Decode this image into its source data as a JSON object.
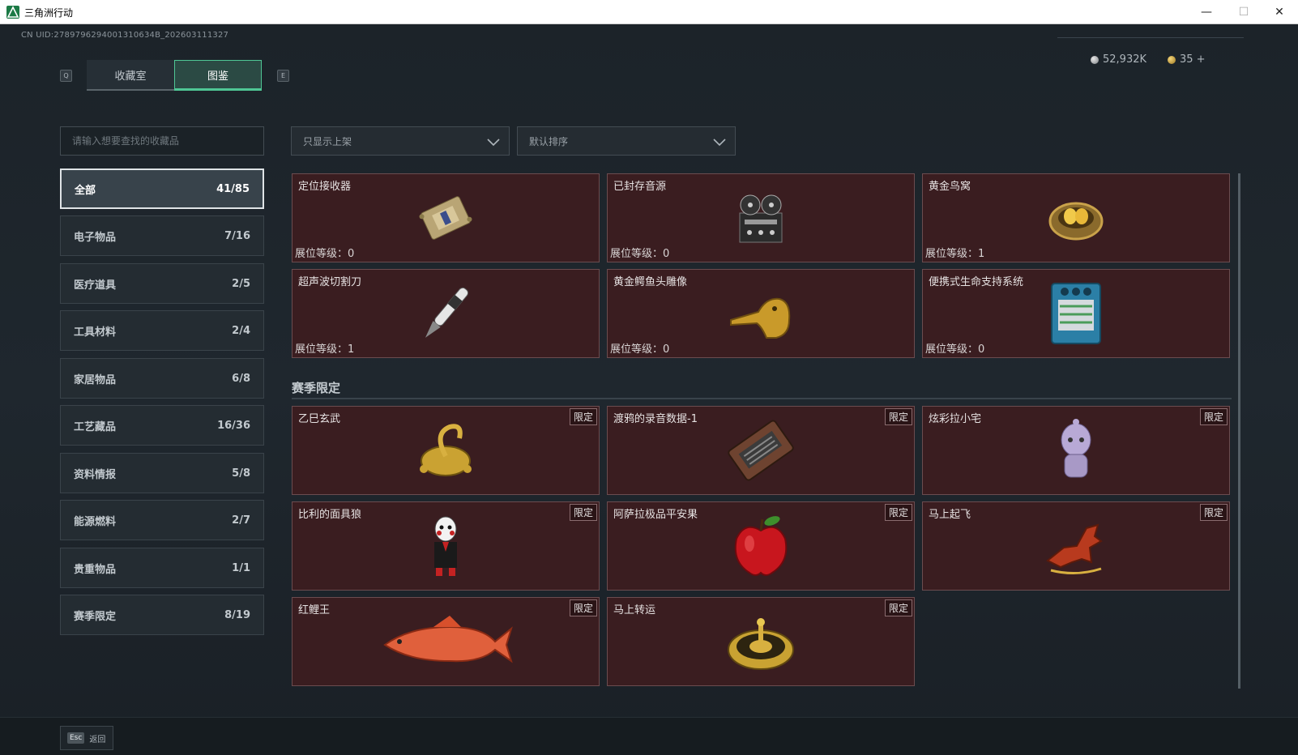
{
  "window": {
    "title": "三角洲行动",
    "min": "—",
    "max": "☐",
    "close": "✕"
  },
  "header": {
    "uid": "CN UID:2789796294001310634B_202603111327",
    "currency_silver": "52,932K",
    "currency_gold": "35 +",
    "key_left": "Q",
    "key_right": "E",
    "tabs": [
      {
        "label": "收藏室"
      },
      {
        "label": "图鉴"
      }
    ],
    "active_tab": "图鉴"
  },
  "search": {
    "placeholder": "请输入想要查找的收藏品"
  },
  "filters": {
    "shelf": "只显示上架",
    "sort": "默认排序"
  },
  "categories": [
    {
      "label": "全部",
      "count": "41/85",
      "active": true
    },
    {
      "label": "电子物品",
      "count": "7/16"
    },
    {
      "label": "医疗道具",
      "count": "2/5"
    },
    {
      "label": "工具材料",
      "count": "2/4"
    },
    {
      "label": "家居物品",
      "count": "6/8"
    },
    {
      "label": "工艺藏品",
      "count": "16/36"
    },
    {
      "label": "资料情报",
      "count": "5/8"
    },
    {
      "label": "能源燃料",
      "count": "2/7"
    },
    {
      "label": "贵重物品",
      "count": "1/1"
    },
    {
      "label": "赛季限定",
      "count": "8/19"
    }
  ],
  "items": [
    {
      "name": "定位接收器",
      "level": "展位等级：0",
      "icon": "locator-receiver-icon"
    },
    {
      "name": "已封存音源",
      "level": "展位等级：0",
      "icon": "reel-recorder-icon"
    },
    {
      "name": "黄金鸟窝",
      "level": "展位等级：1",
      "icon": "golden-nest-icon"
    },
    {
      "name": "超声波切割刀",
      "level": "展位等级：1",
      "icon": "ultrasonic-knife-icon"
    },
    {
      "name": "黄金鳄鱼头雕像",
      "level": "展位等级：0",
      "icon": "golden-crocodile-icon"
    },
    {
      "name": "便携式生命支持系统",
      "level": "展位等级：0",
      "icon": "life-support-icon"
    }
  ],
  "season": {
    "title": "赛季限定",
    "badge": "限定",
    "items": [
      {
        "name": "乙巳玄武",
        "icon": "gold-turtle-snake-icon"
      },
      {
        "name": "渡鸦的录音数据-1",
        "icon": "cassette-icon"
      },
      {
        "name": "炫彩拉小宅",
        "icon": "doll-icon"
      },
      {
        "name": "比利的面具狼",
        "icon": "puppet-icon"
      },
      {
        "name": "阿萨拉极品平安果",
        "icon": "red-apple-icon"
      },
      {
        "name": "马上起飞",
        "icon": "red-horse-icon"
      },
      {
        "name": "红鲤王",
        "icon": "red-carp-icon"
      },
      {
        "name": "马上转运",
        "icon": "gold-wheel-icon"
      }
    ]
  },
  "footer": {
    "key": "Esc",
    "label": "返回"
  }
}
